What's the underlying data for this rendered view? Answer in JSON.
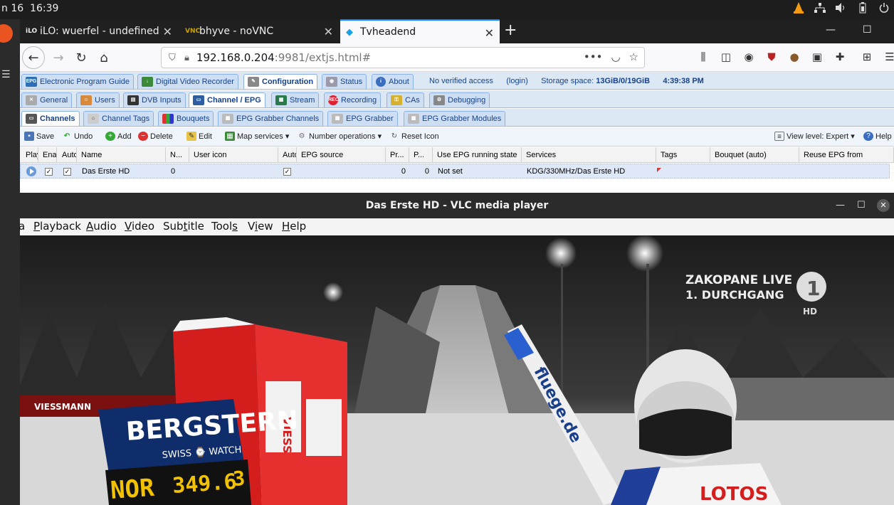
{
  "system_bar": {
    "date": "n 16",
    "time": "16:39"
  },
  "browser": {
    "tabs": [
      {
        "favicon": "iLO",
        "label": "iLO: wuerfel - undefined"
      },
      {
        "favicon": "VNC",
        "label": "bhyve - noVNC"
      },
      {
        "favicon": "◆",
        "label": "Tvheadend"
      }
    ],
    "url_host": "192.168.0.204",
    "url_rest": ":9981/extjs.html#"
  },
  "tvheadend": {
    "main_tabs": [
      "Electronic Program Guide",
      "Digital Video Recorder",
      "Configuration",
      "Status",
      "About"
    ],
    "status": {
      "access": "No verified access",
      "login": "(login)",
      "storage_label": "Storage space:",
      "storage_value": "13GiB/0/19GiB",
      "clock": "4:39:38 PM"
    },
    "config_tabs": [
      "General",
      "Users",
      "DVB Inputs",
      "Channel / EPG",
      "Stream",
      "Recording",
      "CAs",
      "Debugging"
    ],
    "sub_tabs": [
      "Channels",
      "Channel Tags",
      "Bouquets",
      "EPG Grabber Channels",
      "EPG Grabber",
      "EPG Grabber Modules"
    ],
    "actions": {
      "save": "Save",
      "undo": "Undo",
      "add": "Add",
      "delete": "Delete",
      "edit": "Edit",
      "map_services": "Map services",
      "number_operations": "Number operations",
      "reset_icon": "Reset Icon",
      "view_level": "View level: Expert",
      "help": "Help"
    },
    "columns": [
      "Play",
      "Enabled",
      "Auto",
      "Name",
      "N...",
      "User icon",
      "Auto",
      "EPG source",
      "Pr...",
      "P...",
      "Use EPG running state",
      "Services",
      "Tags",
      "Bouquet (auto)",
      "Reuse EPG from"
    ],
    "row": {
      "name": "Das Erste HD",
      "number": "0",
      "pr": "0",
      "p": "0",
      "epg_running": "Not set",
      "services": "KDG/330MHz/Das Erste HD"
    }
  },
  "vlc": {
    "title": "Das Erste HD - VLC media player",
    "menu": [
      {
        "label": "a",
        "key": ""
      },
      {
        "label": "Playback",
        "key": "P"
      },
      {
        "label": "Audio",
        "key": "A"
      },
      {
        "label": "Video",
        "key": "V"
      },
      {
        "label": "Subtitle",
        "key": "t"
      },
      {
        "label": "Tools",
        "key": "s"
      },
      {
        "label": "View",
        "key": "i"
      },
      {
        "label": "Help",
        "key": "H"
      }
    ],
    "overlay": {
      "line1": "ZAKOPANE LIVE",
      "line2": "1. DURCHGANG",
      "channel_mark": "1",
      "hd": "HD"
    },
    "scene": {
      "board_brand": "BERGSTERN",
      "board_sub": "SWISS ⌚ WATCH",
      "score_country": "NOR",
      "score_value": "349.6",
      "score_rank": "3",
      "ski_text": "fluege.de",
      "banner_text": "VIESSMANN",
      "bib_text": "LOTOS"
    }
  }
}
